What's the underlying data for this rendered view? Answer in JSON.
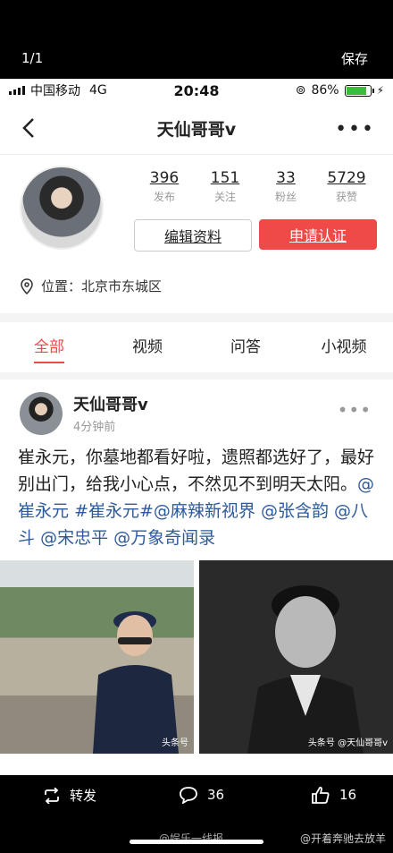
{
  "viewer": {
    "counter": "1/1",
    "save_label": "保存"
  },
  "status_bar": {
    "carrier": "中国移动",
    "network": "4G",
    "time": "20:48",
    "battery": "86%",
    "battery_level": 0.86
  },
  "nav": {
    "title": "天仙哥哥v"
  },
  "profile": {
    "stats": [
      {
        "value": "396",
        "label": "发布"
      },
      {
        "value": "151",
        "label": "关注"
      },
      {
        "value": "33",
        "label": "粉丝"
      },
      {
        "value": "5729",
        "label": "获赞"
      }
    ],
    "edit_label": "编辑资料",
    "verify_label": "申请认证",
    "location": "位置：北京市东城区"
  },
  "tabs": [
    "全部",
    "视频",
    "问答",
    "小视频"
  ],
  "post": {
    "author": "天仙哥哥v",
    "time": "4分钟前",
    "text_plain": "崔永元，你墓地都看好啦，遗照都选好了，最好别出门，给我小心点，不然见不到明天太阳。",
    "tags": [
      "@崔永元",
      "#崔永元#",
      "@麻辣新视界",
      "@张含韵",
      "@八斗",
      "@宋忠平",
      "@万象奇闻录"
    ],
    "watermark_left": "头条号",
    "watermark_right": "头条号 @天仙哥哥v"
  },
  "bottom_bar": {
    "repost_label": "转发",
    "comments": "36",
    "likes": "16",
    "weibo_left": "@娱乐一线报",
    "weibo_right": "@开着奔驰去放羊"
  }
}
